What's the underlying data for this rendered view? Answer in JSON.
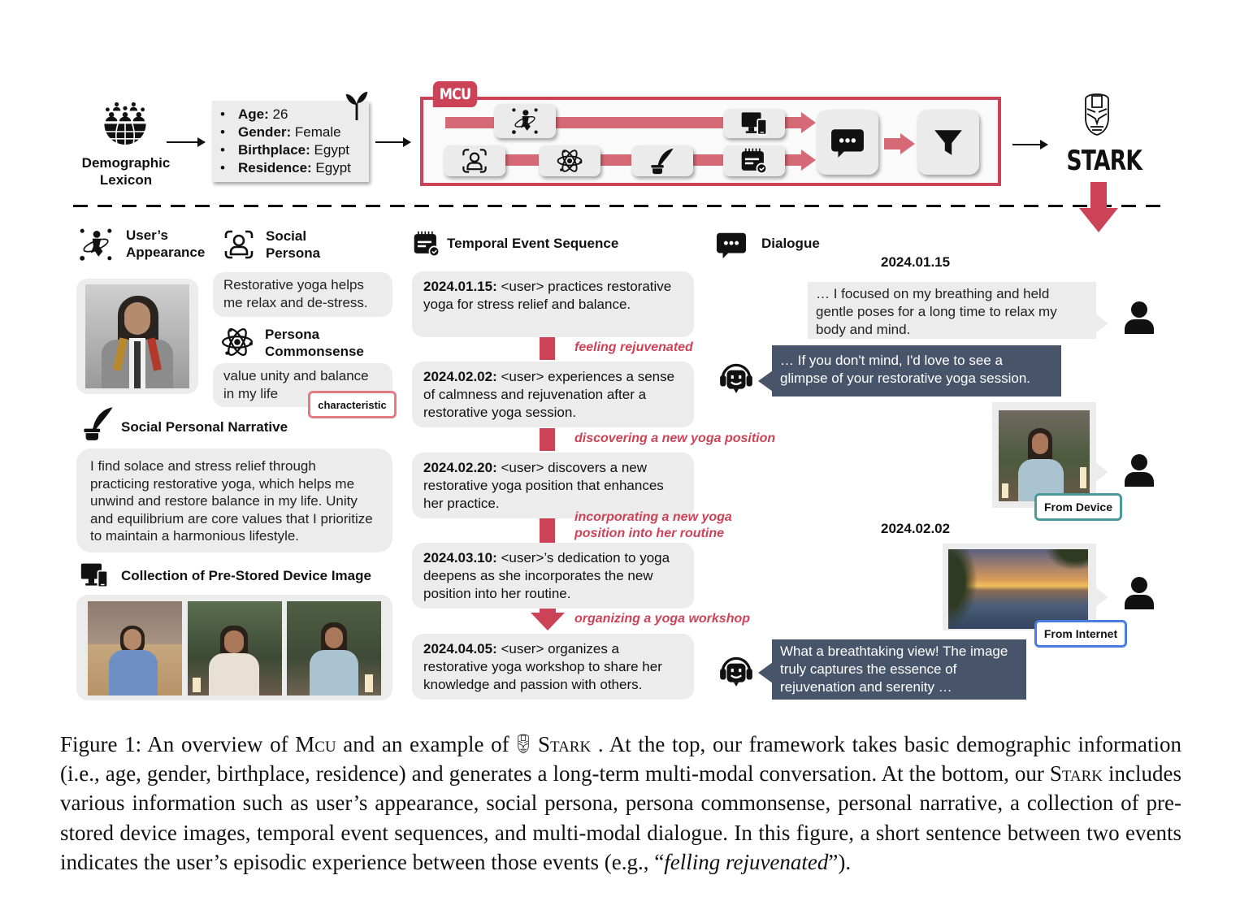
{
  "top": {
    "demographic_label": "Demographic Lexicon",
    "demographic_line1": "Demographic",
    "demographic_line2": "Lexicon",
    "attributes": [
      {
        "key": "Age:",
        "value": " 26"
      },
      {
        "key": "Gender:",
        "value": " Female"
      },
      {
        "key": "Birthplace:",
        "value": " Egypt"
      },
      {
        "key": "Residence:",
        "value": " Egypt"
      }
    ],
    "mcu_tag": "MCU",
    "stark_label": "STARK",
    "pipeline_icons": [
      "appearance-icon",
      "device-icon",
      "social-persona-icon",
      "atom-icon",
      "quill-icon",
      "calendar-check-icon",
      "chat-icon",
      "filter-icon"
    ]
  },
  "sections": {
    "appearance_line1": "User’s",
    "appearance_line2": "Appearance",
    "social_persona_line1": "Social",
    "social_persona_line2": "Persona",
    "social_persona_text": "Restorative yoga helps me relax and de-stress.",
    "commonsense_line1": "Persona",
    "commonsense_line2": "Commonsense",
    "commonsense_text": "value unity and balance in my life",
    "commonsense_tag": "characteristic",
    "narrative_title": "Social Personal Narrative",
    "narrative_text": "I find solace and stress relief through practicing restorative yoga, which helps me unwind and restore balance in my life. Unity and equilibrium are core values that I prioritize to maintain a harmonious lifestyle.",
    "device_title": "Collection of Pre-Stored Device Image"
  },
  "timeline": {
    "title": "Temporal Event Sequence",
    "events": [
      {
        "date": "2024.01.15:",
        "text": " <user> practices restorative yoga for stress relief and balance."
      },
      {
        "date": "2024.02.02:",
        "text": " <user> experiences a sense of calmness and rejuvenation after a restorative yoga session."
      },
      {
        "date": "2024.02.20:",
        "text": " <user> discovers a new restorative yoga position that enhances her practice."
      },
      {
        "date": "2024.03.10:",
        "text": " <user>’s dedication to yoga deepens as she incorporates the new position into her routine."
      },
      {
        "date": "2024.04.05:",
        "text": " <user> organizes a restorative yoga workshop to share her knowledge and passion with others."
      }
    ],
    "transitions": [
      "feeling rejuvenated",
      "discovering a new yoga position",
      "incorporating a new yoga position into her routine",
      "organizing a yoga workshop"
    ]
  },
  "dialogue": {
    "title": "Dialogue",
    "sessions": [
      {
        "date": "2024.01.15",
        "user_msg": "… I focused on my breathing and held gentle poses for a long time to relax my body and mind.",
        "bot_msg": "… If you don't mind, I'd love to see a glimpse of your restorative yoga session.",
        "image_source": "From Device"
      },
      {
        "date": "2024.02.02",
        "image_source": "From Internet",
        "bot_msg": "What a breathtaking view! The image truly captures the essence of rejuvenation and serenity …"
      }
    ],
    "colors": {
      "device_tag": "#4a9a9c",
      "internet_tag": "#4a7de0",
      "bot_bubble": "#48546a",
      "accent": "#cc4358"
    }
  },
  "caption": {
    "p1": "Figure 1: An overview of ",
    "mcu": "Mcu",
    "p2": " and an example of ",
    "stark1": "Stark",
    "p3": " . At the top, our framework takes basic demographic information (i.e., age, gender, birthplace, residence) and generates a long-term multi-modal conversation. At the bottom, our ",
    "stark2": "Stark",
    "p4": " includes various information such as user’s appearance, social persona, persona commonsense, personal narrative, a collection of pre-stored device images, temporal event sequences, and multi-modal dialogue. In this figure, a short sentence between two events indicates the user’s episodic experience between those events (e.g., “",
    "italic": "felling rejuvenated",
    "p5": "”)."
  }
}
